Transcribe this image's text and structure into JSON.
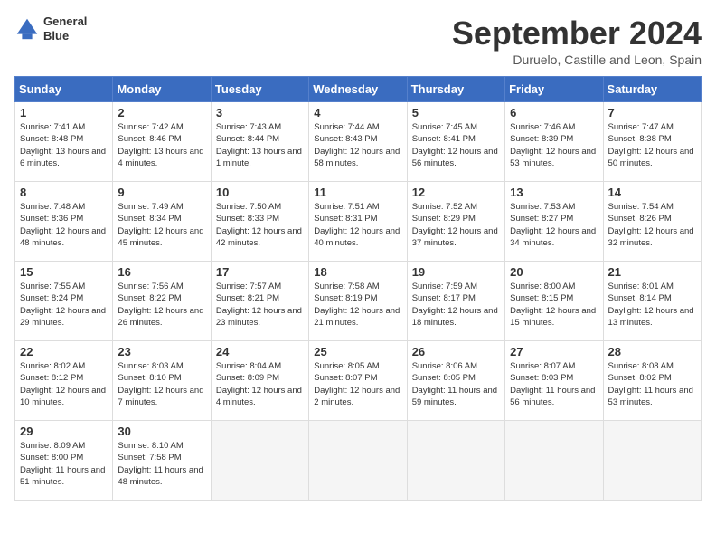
{
  "header": {
    "logo_line1": "General",
    "logo_line2": "Blue",
    "month_title": "September 2024",
    "location": "Duruelo, Castille and Leon, Spain"
  },
  "weekdays": [
    "Sunday",
    "Monday",
    "Tuesday",
    "Wednesday",
    "Thursday",
    "Friday",
    "Saturday"
  ],
  "weeks": [
    [
      {
        "day": "1",
        "sunrise": "7:41 AM",
        "sunset": "8:48 PM",
        "daylight": "13 hours and 6 minutes."
      },
      {
        "day": "2",
        "sunrise": "7:42 AM",
        "sunset": "8:46 PM",
        "daylight": "13 hours and 4 minutes."
      },
      {
        "day": "3",
        "sunrise": "7:43 AM",
        "sunset": "8:44 PM",
        "daylight": "13 hours and 1 minute."
      },
      {
        "day": "4",
        "sunrise": "7:44 AM",
        "sunset": "8:43 PM",
        "daylight": "12 hours and 58 minutes."
      },
      {
        "day": "5",
        "sunrise": "7:45 AM",
        "sunset": "8:41 PM",
        "daylight": "12 hours and 56 minutes."
      },
      {
        "day": "6",
        "sunrise": "7:46 AM",
        "sunset": "8:39 PM",
        "daylight": "12 hours and 53 minutes."
      },
      {
        "day": "7",
        "sunrise": "7:47 AM",
        "sunset": "8:38 PM",
        "daylight": "12 hours and 50 minutes."
      }
    ],
    [
      {
        "day": "8",
        "sunrise": "7:48 AM",
        "sunset": "8:36 PM",
        "daylight": "12 hours and 48 minutes."
      },
      {
        "day": "9",
        "sunrise": "7:49 AM",
        "sunset": "8:34 PM",
        "daylight": "12 hours and 45 minutes."
      },
      {
        "day": "10",
        "sunrise": "7:50 AM",
        "sunset": "8:33 PM",
        "daylight": "12 hours and 42 minutes."
      },
      {
        "day": "11",
        "sunrise": "7:51 AM",
        "sunset": "8:31 PM",
        "daylight": "12 hours and 40 minutes."
      },
      {
        "day": "12",
        "sunrise": "7:52 AM",
        "sunset": "8:29 PM",
        "daylight": "12 hours and 37 minutes."
      },
      {
        "day": "13",
        "sunrise": "7:53 AM",
        "sunset": "8:27 PM",
        "daylight": "12 hours and 34 minutes."
      },
      {
        "day": "14",
        "sunrise": "7:54 AM",
        "sunset": "8:26 PM",
        "daylight": "12 hours and 32 minutes."
      }
    ],
    [
      {
        "day": "15",
        "sunrise": "7:55 AM",
        "sunset": "8:24 PM",
        "daylight": "12 hours and 29 minutes."
      },
      {
        "day": "16",
        "sunrise": "7:56 AM",
        "sunset": "8:22 PM",
        "daylight": "12 hours and 26 minutes."
      },
      {
        "day": "17",
        "sunrise": "7:57 AM",
        "sunset": "8:21 PM",
        "daylight": "12 hours and 23 minutes."
      },
      {
        "day": "18",
        "sunrise": "7:58 AM",
        "sunset": "8:19 PM",
        "daylight": "12 hours and 21 minutes."
      },
      {
        "day": "19",
        "sunrise": "7:59 AM",
        "sunset": "8:17 PM",
        "daylight": "12 hours and 18 minutes."
      },
      {
        "day": "20",
        "sunrise": "8:00 AM",
        "sunset": "8:15 PM",
        "daylight": "12 hours and 15 minutes."
      },
      {
        "day": "21",
        "sunrise": "8:01 AM",
        "sunset": "8:14 PM",
        "daylight": "12 hours and 13 minutes."
      }
    ],
    [
      {
        "day": "22",
        "sunrise": "8:02 AM",
        "sunset": "8:12 PM",
        "daylight": "12 hours and 10 minutes."
      },
      {
        "day": "23",
        "sunrise": "8:03 AM",
        "sunset": "8:10 PM",
        "daylight": "12 hours and 7 minutes."
      },
      {
        "day": "24",
        "sunrise": "8:04 AM",
        "sunset": "8:09 PM",
        "daylight": "12 hours and 4 minutes."
      },
      {
        "day": "25",
        "sunrise": "8:05 AM",
        "sunset": "8:07 PM",
        "daylight": "12 hours and 2 minutes."
      },
      {
        "day": "26",
        "sunrise": "8:06 AM",
        "sunset": "8:05 PM",
        "daylight": "11 hours and 59 minutes."
      },
      {
        "day": "27",
        "sunrise": "8:07 AM",
        "sunset": "8:03 PM",
        "daylight": "11 hours and 56 minutes."
      },
      {
        "day": "28",
        "sunrise": "8:08 AM",
        "sunset": "8:02 PM",
        "daylight": "11 hours and 53 minutes."
      }
    ],
    [
      {
        "day": "29",
        "sunrise": "8:09 AM",
        "sunset": "8:00 PM",
        "daylight": "11 hours and 51 minutes."
      },
      {
        "day": "30",
        "sunrise": "8:10 AM",
        "sunset": "7:58 PM",
        "daylight": "11 hours and 48 minutes."
      },
      null,
      null,
      null,
      null,
      null
    ]
  ]
}
